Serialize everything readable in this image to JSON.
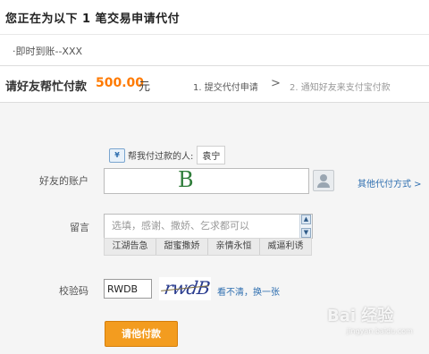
{
  "header": {
    "title": "您正在为以下  1 笔交易申请代付"
  },
  "order": {
    "item": "·即时到账--XXX"
  },
  "amount": {
    "label": "请好友帮忙付款",
    "value": "500.00",
    "unit": "元"
  },
  "steps": [
    {
      "label": "1. 提交代付申请"
    },
    {
      "label": "2. 通知好友来支付宝付款"
    }
  ],
  "step_separator": ">",
  "past_payer": {
    "icon": "¥",
    "label": "帮我付过款的人:",
    "name": "袁宁"
  },
  "account": {
    "label": "好友的账户",
    "value": "B"
  },
  "other_method": {
    "label": "其他代付方式 >"
  },
  "message": {
    "label": "留言",
    "placeholder": "选填，感谢、撒娇、乞求都可以"
  },
  "quick_phrases": [
    "江湖告急",
    "甜蜜撒娇",
    "亲情永恒",
    "威逼利诱"
  ],
  "verify": {
    "label": "校验码",
    "value": "RWDB",
    "captcha_text": "rwdB",
    "refresh_label": "看不清，换一张"
  },
  "submit": {
    "label": "请他付款"
  },
  "watermark": {
    "text": "Bai 经验",
    "sub": "jingyan.baidu.com"
  },
  "colors": {
    "accent_orange": "#f39c1f",
    "amount_orange": "#ff7a00",
    "link_blue": "#2f6fb0",
    "form_bg": "#f5f5f5"
  }
}
